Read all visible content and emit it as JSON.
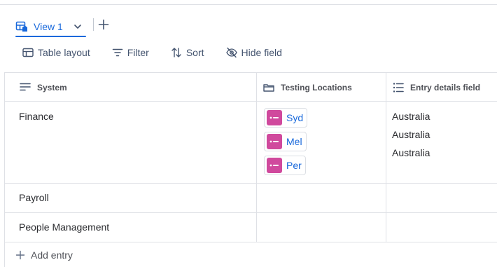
{
  "view_tab": {
    "label": "View 1",
    "icon": "table-view-icon"
  },
  "toolbar": {
    "layout_label": "Table layout",
    "filter_label": "Filter",
    "sort_label": "Sort",
    "hide_field_label": "Hide field"
  },
  "columns": [
    {
      "label": "System",
      "icon": "text-lines-icon"
    },
    {
      "label": "Testing Locations",
      "icon": "container-icon"
    },
    {
      "label": "Entry details field",
      "icon": "list-icon"
    }
  ],
  "rows": [
    {
      "system": "Finance",
      "locations": [
        "Syd",
        "Mel",
        "Per"
      ],
      "details": [
        "Australia",
        "Australia",
        "Australia"
      ]
    },
    {
      "system": "Payroll",
      "locations": [],
      "details": []
    },
    {
      "system": "People Management",
      "locations": [],
      "details": []
    }
  ],
  "add_entry_label": "Add entry",
  "colors": {
    "accent": "#1868db",
    "chip": "#d0499d",
    "border": "#dfe1e6"
  }
}
